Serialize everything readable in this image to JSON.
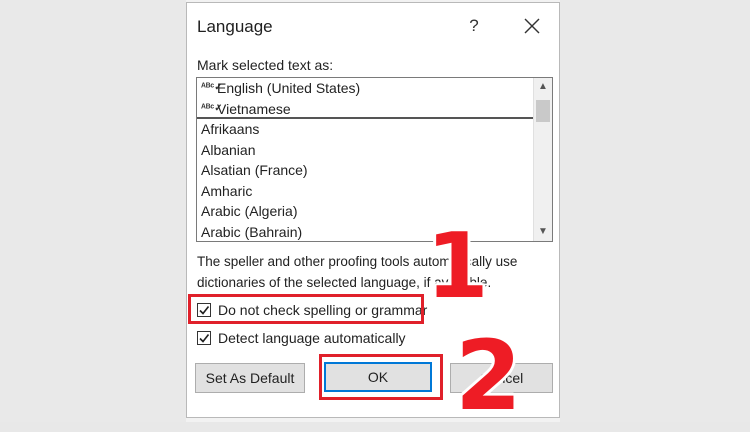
{
  "dialog": {
    "title": "Language",
    "help_label": "?",
    "mark_label": "Mark selected text as:",
    "languages": [
      {
        "label": "English (United States)",
        "spell": true
      },
      {
        "label": "Vietnamese",
        "spell": true
      },
      {
        "label": "Afrikaans",
        "spell": false
      },
      {
        "label": "Albanian",
        "spell": false
      },
      {
        "label": "Alsatian (France)",
        "spell": false
      },
      {
        "label": "Amharic",
        "spell": false
      },
      {
        "label": "Arabic (Algeria)",
        "spell": false
      },
      {
        "label": "Arabic (Bahrain)",
        "spell": false
      }
    ],
    "spell_glyph": "ᴬᴮᶜ✓",
    "info_line1": "The speller and other proofing tools automatically use",
    "info_line2": "dictionaries of the selected language, if available.",
    "no_check_label": "Do not check spelling or grammar",
    "no_check_checked": true,
    "detect_label": "Detect language automatically",
    "detect_checked": true,
    "set_default_label": "Set As Default",
    "ok_label": "OK",
    "cancel_label": "Cancel"
  },
  "annotations": {
    "marker_1": "1",
    "marker_2": "2",
    "highlight_color": "#e0202a"
  },
  "colors": {
    "accent": "#0078d7",
    "marker": "#ee1c25"
  }
}
